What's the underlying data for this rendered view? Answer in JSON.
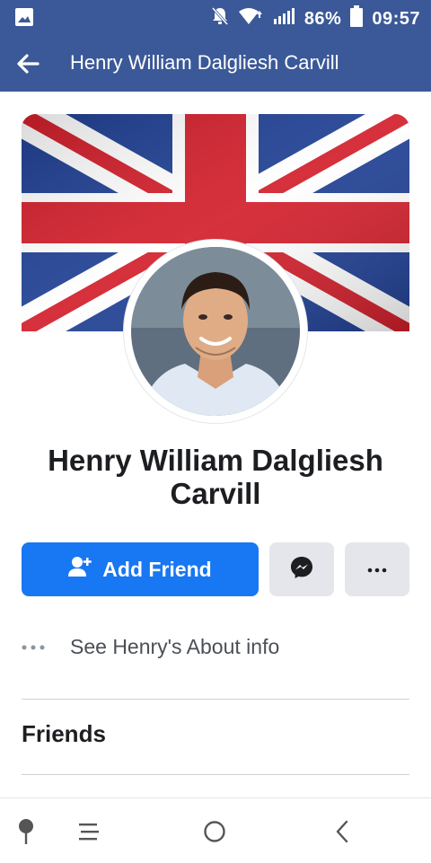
{
  "status_bar": {
    "battery": "86%",
    "time": "09:57",
    "icons": [
      "gallery-icon",
      "mute-icon",
      "wifi-icon",
      "signal-icon",
      "battery-icon"
    ]
  },
  "header": {
    "title": "Henry William Dalgliesh Carvill",
    "back_icon": "arrow-left-icon"
  },
  "profile": {
    "name": "Henry William Dalgliesh Carvill",
    "cover_image": "union-jack-flag",
    "avatar_image": "profile-photo"
  },
  "actions": {
    "add_friend_label": "Add Friend",
    "add_friend_icon": "add-person-icon",
    "messenger_icon": "messenger-icon",
    "more_icon": "more-icon"
  },
  "about": {
    "label": "See Henry's About info"
  },
  "sections": {
    "friends_title": "Friends"
  },
  "nav": {
    "items": [
      "pin-icon",
      "menu-icon",
      "home-circle-icon",
      "back-chevron-icon"
    ]
  },
  "colors": {
    "header_bg": "#3b5998",
    "primary_button": "#1877f2",
    "secondary_button": "#e4e6eb",
    "text": "#1c1e21"
  }
}
